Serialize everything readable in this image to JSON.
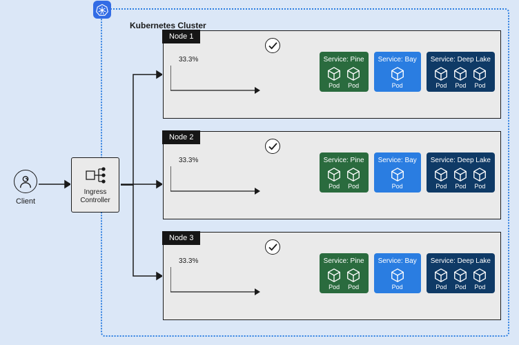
{
  "cluster_title": "Kubernetes Cluster",
  "client_label": "Client",
  "ingress_label": "Ingress Controller",
  "nodes": [
    {
      "title": "Node 1",
      "split": "33.3%"
    },
    {
      "title": "Node 2",
      "split": "33.3%"
    },
    {
      "title": "Node 3",
      "split": "33.3%"
    }
  ],
  "services": {
    "pine": {
      "title": "Service: Pine",
      "pods": [
        "Pod",
        "Pod"
      ]
    },
    "bay": {
      "title": "Service: Bay",
      "pods": [
        "Pod"
      ]
    },
    "deep": {
      "title": "Service: Deep Lake",
      "pods": [
        "Pod",
        "Pod",
        "Pod"
      ]
    }
  },
  "chart_data": {
    "type": "diagram",
    "title": "Kubernetes Cluster",
    "external": [
      "Client",
      "Ingress Controller"
    ],
    "nodes": [
      {
        "name": "Node 1",
        "traffic_share_pct": 33.3,
        "selected_service": "Pine",
        "services": [
          {
            "name": "Pine",
            "pods": 2,
            "color": "#2a6b3e"
          },
          {
            "name": "Bay",
            "pods": 1,
            "color": "#2a7de1"
          },
          {
            "name": "Deep Lake",
            "pods": 3,
            "color": "#0f3a66"
          }
        ]
      },
      {
        "name": "Node 2",
        "traffic_share_pct": 33.3,
        "selected_service": "Pine",
        "services": [
          {
            "name": "Pine",
            "pods": 2,
            "color": "#2a6b3e"
          },
          {
            "name": "Bay",
            "pods": 1,
            "color": "#2a7de1"
          },
          {
            "name": "Deep Lake",
            "pods": 3,
            "color": "#0f3a66"
          }
        ]
      },
      {
        "name": "Node 3",
        "traffic_share_pct": 33.3,
        "selected_service": "Pine",
        "services": [
          {
            "name": "Pine",
            "pods": 2,
            "color": "#2a6b3e"
          },
          {
            "name": "Bay",
            "pods": 1,
            "color": "#2a7de1"
          },
          {
            "name": "Deep Lake",
            "pods": 3,
            "color": "#0f3a66"
          }
        ]
      }
    ],
    "edges": [
      {
        "from": "Client",
        "to": "Ingress Controller"
      },
      {
        "from": "Ingress Controller",
        "to": "Node 1"
      },
      {
        "from": "Ingress Controller",
        "to": "Node 2"
      },
      {
        "from": "Ingress Controller",
        "to": "Node 3"
      }
    ]
  }
}
